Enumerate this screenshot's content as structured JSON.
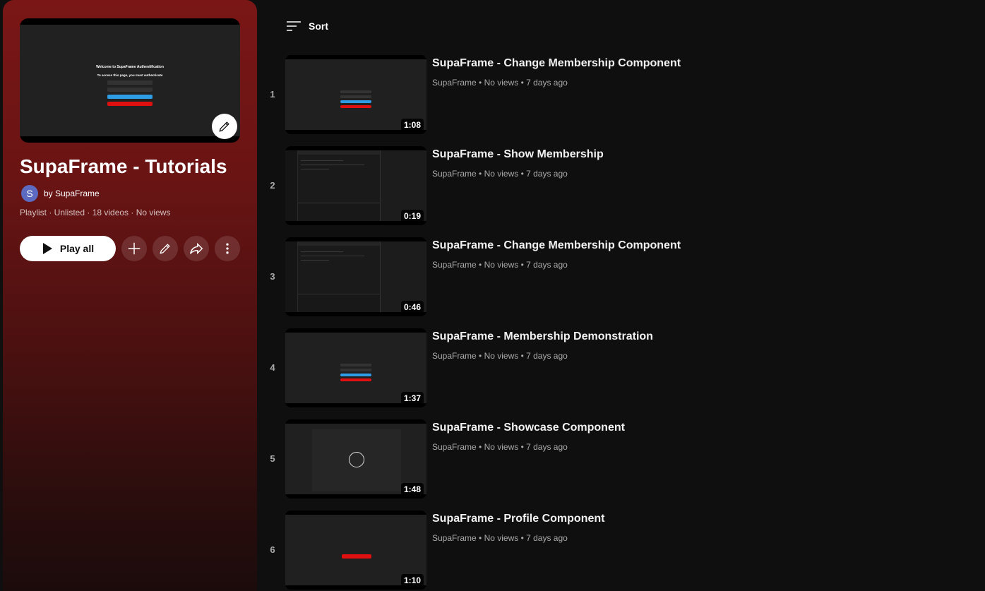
{
  "panel": {
    "thumbnail": {
      "heading": "Welcome to SupaFrame Authentification",
      "subheading": "To access this page, you must authenticate"
    },
    "title": "SupaFrame - Tutorials",
    "owner": {
      "avatar_letter": "S",
      "label": "by SupaFrame"
    },
    "meta": "Playlist · Unlisted · 18 videos · No views",
    "play_all_label": "Play all",
    "icons": {
      "edit_thumbnail": "pencil-icon",
      "play": "play-icon",
      "add": "plus-icon",
      "edit": "pencil-icon",
      "share": "share-icon",
      "more": "more-vert-icon"
    }
  },
  "sort": {
    "label": "Sort",
    "icon": "sort-icon"
  },
  "videos": [
    {
      "index": "1",
      "title": "SupaFrame - Change Membership Component",
      "meta": "SupaFrame • No views • 7 days ago",
      "duration": "1:08",
      "thumb": "auth"
    },
    {
      "index": "2",
      "title": "SupaFrame - Show Membership",
      "meta": "SupaFrame • No views • 7 days ago",
      "duration": "0:19",
      "thumb": "editor"
    },
    {
      "index": "3",
      "title": "SupaFrame - Change Membership Component",
      "meta": "SupaFrame • No views • 7 days ago",
      "duration": "0:46",
      "thumb": "editor"
    },
    {
      "index": "4",
      "title": "SupaFrame - Membership Demonstration",
      "meta": "SupaFrame • No views • 7 days ago",
      "duration": "1:37",
      "thumb": "auth-highlight"
    },
    {
      "index": "5",
      "title": "SupaFrame - Showcase Component",
      "meta": "SupaFrame • No views • 7 days ago",
      "duration": "1:48",
      "thumb": "showcase"
    },
    {
      "index": "6",
      "title": "SupaFrame - Profile Component",
      "meta": "SupaFrame • No views • 7 days ago",
      "duration": "1:10",
      "thumb": "profile"
    }
  ],
  "colors": {
    "panel_top": "#7a1616",
    "page_bg": "#0f0f0f",
    "accent_blue": "#2e9de5",
    "accent_red": "#e01010"
  }
}
